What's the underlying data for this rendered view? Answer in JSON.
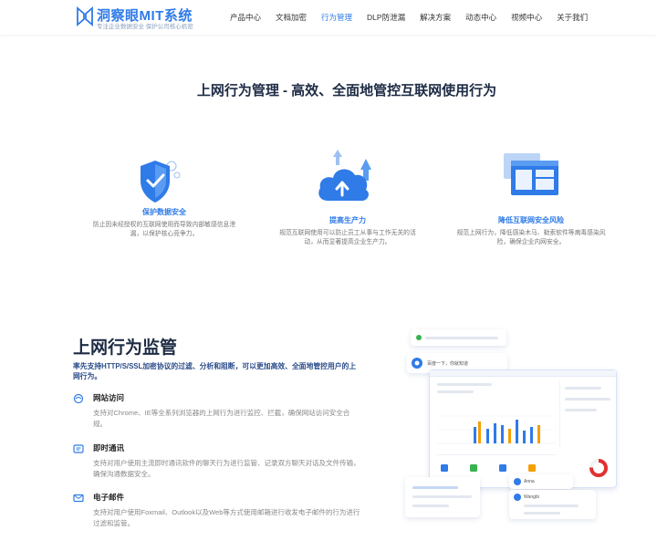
{
  "brand": {
    "name": "洞察眼MIT系统",
    "tagline": "专注企业数据安全 保护公司核心机密"
  },
  "nav": {
    "items": [
      "产品中心",
      "文档加密",
      "行为管理",
      "DLP防泄漏",
      "解决方案",
      "动态中心",
      "视频中心",
      "关于我们"
    ],
    "active_index": 2
  },
  "hero": {
    "title": "上网行为管理 - 高效、全面地管控互联网使用行为",
    "features": [
      {
        "title": "保护数据安全",
        "desc": "防止因未经授权的互联网使用而导致内部敏感信息泄漏，以保护核心竞争力。"
      },
      {
        "title": "提高生产力",
        "desc": "规范互联网使用可以防止员工从事与工作无关的活动，从而显著提高企业生产力。"
      },
      {
        "title": "降低互联网安全风险",
        "desc": "规范上网行为，降低感染木马、勒索软件等病毒感染风险，确保企业内网安全。"
      }
    ]
  },
  "section": {
    "title": "上网行为监管",
    "subtitle": "率先支持HTTP/S/SSL加密协议的过滤、分析和阻断，可以更加高效、全面地管控用户的上网行为。",
    "items": [
      {
        "title": "网站访问",
        "desc": "支持对Chrome、IE等全系列浏览器的上网行为进行监控、拦截，确保网站访问安全合规。"
      },
      {
        "title": "即时通讯",
        "desc": "支持对用户使用主流即时通讯软件的聊天行为进行监管、记录双方聊天对话及文件传输，确保沟通数据安全。"
      },
      {
        "title": "电子邮件",
        "desc": "支持对用户使用Foxmail、Outlook以及Web等方式使用邮箱进行收发电子邮件的行为进行过滤和监管。"
      }
    ]
  },
  "mockup": {
    "search_text": "百度一下，你就知道",
    "contacts": [
      "Anna",
      "Wangbi"
    ]
  },
  "colors": {
    "accent": "#2f7be8",
    "title": "#1d2b44"
  }
}
